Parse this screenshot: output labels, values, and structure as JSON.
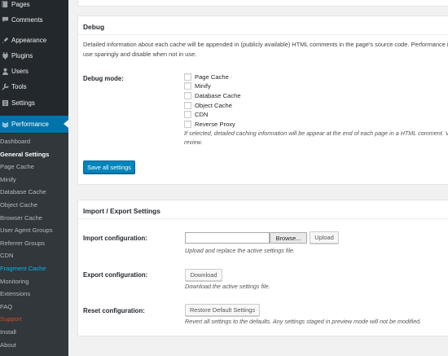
{
  "sidebar": {
    "top_items": [
      {
        "label": "Pages",
        "icon": "pages-icon"
      },
      {
        "label": "Comments",
        "icon": "comments-icon"
      },
      {
        "label": "Appearance",
        "icon": "appearance-icon"
      },
      {
        "label": "Plugins",
        "icon": "plugins-icon"
      },
      {
        "label": "Users",
        "icon": "users-icon"
      },
      {
        "label": "Tools",
        "icon": "tools-icon"
      },
      {
        "label": "Settings",
        "icon": "settings-icon"
      }
    ],
    "active_item": {
      "label": "Performance",
      "icon": "performance-icon"
    },
    "submenu": [
      {
        "label": "Dashboard"
      },
      {
        "label": "General Settings",
        "current": true
      },
      {
        "label": "Page Cache"
      },
      {
        "label": "Minify"
      },
      {
        "label": "Database Cache"
      },
      {
        "label": "Object Cache"
      },
      {
        "label": "Browser Cache"
      },
      {
        "label": "User Agent Groups"
      },
      {
        "label": "Referrer Groups"
      },
      {
        "label": "CDN"
      },
      {
        "label": "Fragment Cache",
        "color": "teal"
      },
      {
        "label": "Monitoring"
      },
      {
        "label": "Extensions"
      },
      {
        "label": "FAQ"
      },
      {
        "label": "Support",
        "color": "red"
      },
      {
        "label": "Install"
      },
      {
        "label": "About"
      }
    ]
  },
  "debug": {
    "title": "Debug",
    "description": "Detailed information about each cache will be appended in (publicly available) HTML comments in the page's source code. Performance in use sparingly and disable when not in use.",
    "mode_label": "Debug mode:",
    "options": [
      "Page Cache",
      "Minify",
      "Database Cache",
      "Object Cache",
      "CDN",
      "Reverse Proxy"
    ],
    "note": "If selected, detailed caching information will be appear at the end of each page in a HTML comment. V review.",
    "save_label": "Save all settings"
  },
  "import_export": {
    "title": "Import / Export Settings",
    "import_label": "Import configuration:",
    "browse_label": "Browse...",
    "upload_label": "Upload",
    "import_note": "Upload and replace the active settings file.",
    "export_label": "Export configuration:",
    "download_label": "Download",
    "export_note": "Download the active settings file.",
    "reset_label": "Reset configuration:",
    "restore_label": "Restore Default Settings",
    "reset_note": "Revert all settings to the defaults. Any settings staged in preview mode will not be modified."
  },
  "colors": {
    "sidebar_bg": "#23282d",
    "submenu_bg": "#32373c",
    "accent": "#0073aa",
    "primary_button": "#0085ba",
    "teal_link": "#00b9eb",
    "red_link": "#d54e21"
  }
}
